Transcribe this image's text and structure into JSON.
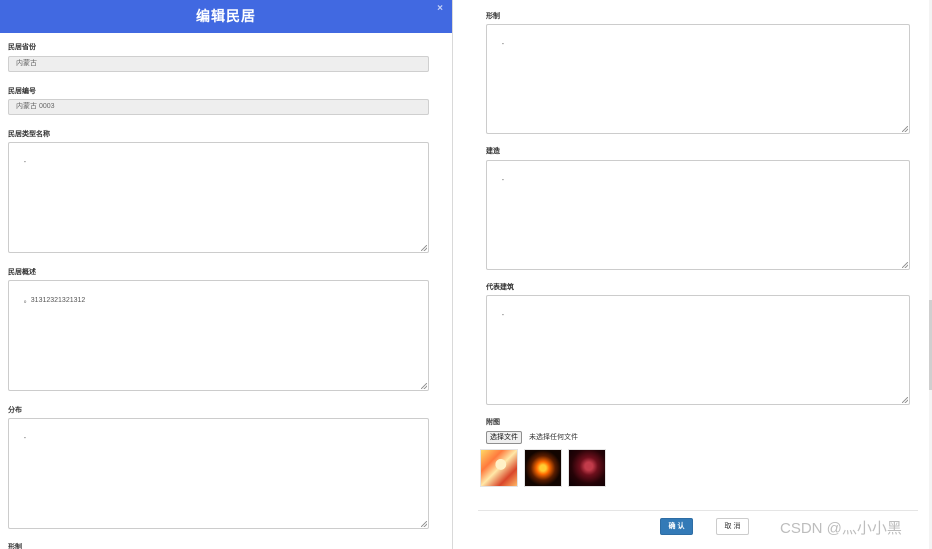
{
  "modal": {
    "title": "编辑民居",
    "close_glyph": "×"
  },
  "fields": {
    "province": {
      "label": "民居省份",
      "value": "内蒙古"
    },
    "number": {
      "label": "民居编号",
      "value": "内蒙古 0003"
    },
    "type_name": {
      "label": "民居类型名称",
      "value": "-"
    },
    "overview": {
      "label": "民居概述",
      "value": "。31312321321312"
    },
    "distribution": {
      "label": "分布",
      "value": "-"
    },
    "shape_cut": {
      "label": "形制"
    },
    "shape": {
      "label": "形制",
      "value": "-"
    },
    "construction": {
      "label": "建造",
      "value": "-"
    },
    "representative": {
      "label": "代表建筑",
      "value": "-"
    }
  },
  "attachment": {
    "label": "附图",
    "choose_button": "选择文件",
    "status": "未选择任何文件",
    "thumbnails": [
      "thumbnail-image-1",
      "thumbnail-image-2",
      "thumbnail-image-3"
    ]
  },
  "footer": {
    "confirm_label": "确 认",
    "cancel_label": "取 消"
  },
  "watermark": "CSDN @灬小小黑",
  "colors": {
    "header": "#4169e1",
    "confirm": "#337ab7"
  }
}
